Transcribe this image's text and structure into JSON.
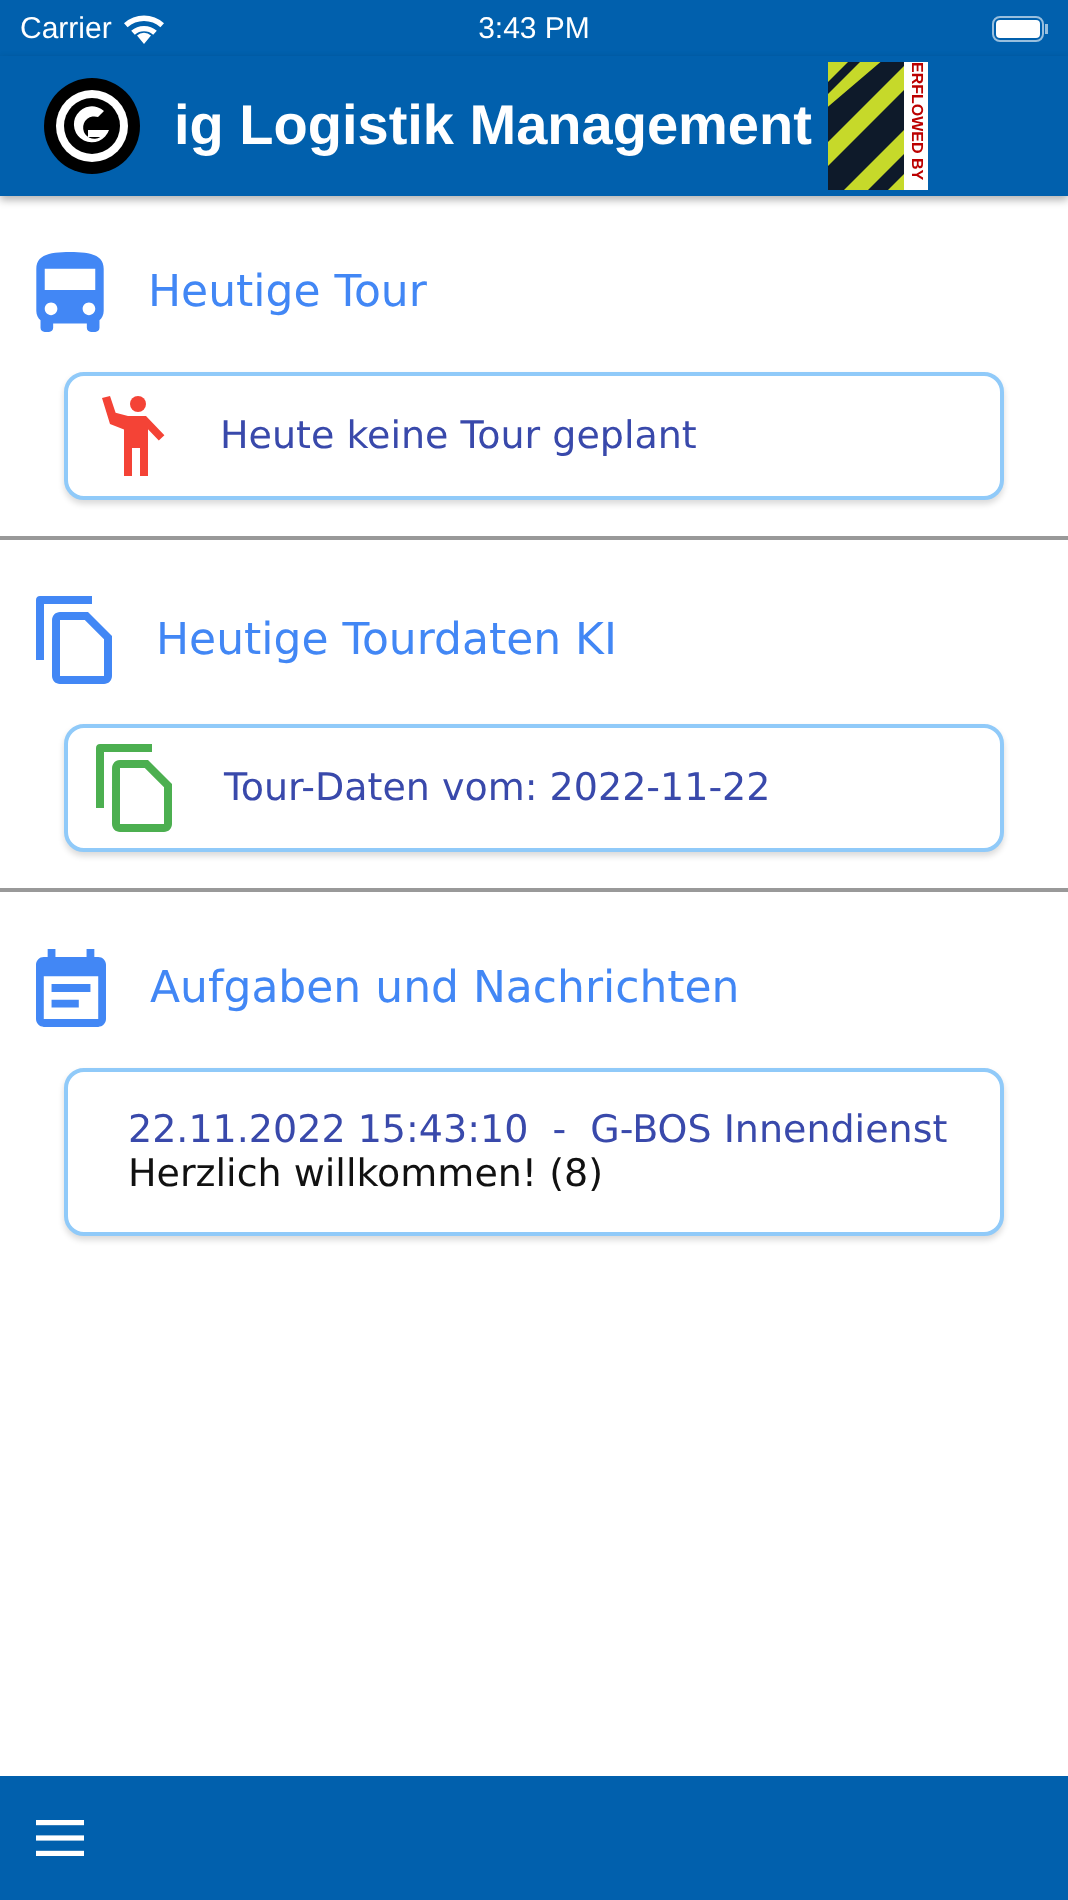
{
  "status_bar": {
    "carrier": "Carrier",
    "time": "3:43 PM"
  },
  "app_bar": {
    "title": "ig Logistik Management",
    "overflow_label": "ERFLOWED BY"
  },
  "sections": [
    {
      "title": "Heutige Tour",
      "card": {
        "kind": "icon",
        "text": "Heute keine Tour geplant"
      }
    },
    {
      "title": "Heutige Tourdaten KI",
      "card": {
        "kind": "icon",
        "text": "Tour-Daten vom: 2022-11-22"
      }
    },
    {
      "title": "Aufgaben und Nachrichten",
      "card": {
        "kind": "message",
        "header": "22.11.2022 15:43:10  -  G-BOS Innendienst",
        "text": "Herzlich willkommen! (8)"
      }
    }
  ]
}
